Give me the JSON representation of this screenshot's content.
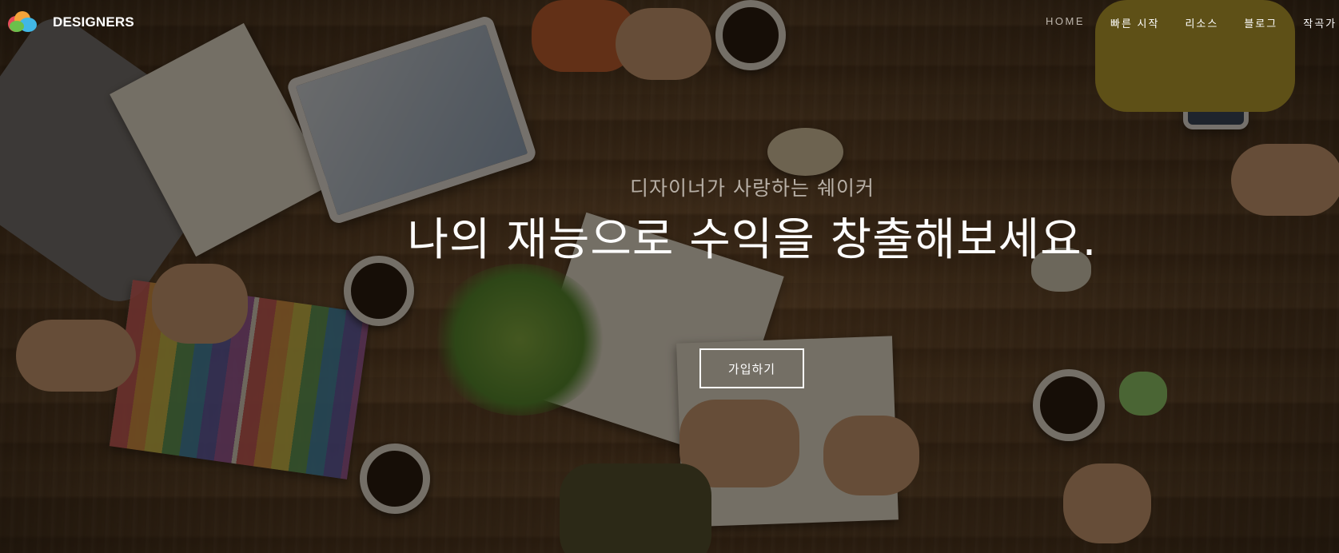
{
  "brand": {
    "name": "DESIGNERS",
    "logo_icon": "colorful-cloud-logo-icon",
    "logo_colors": [
      "#e84b5b",
      "#f3a33a",
      "#41b7e6",
      "#6bc04b"
    ]
  },
  "nav": {
    "items": [
      {
        "label": "HOME",
        "active": true
      },
      {
        "label": "빠른 시작",
        "active": false
      },
      {
        "label": "리소스",
        "active": false
      },
      {
        "label": "블로그",
        "active": false
      },
      {
        "label": "작곡가",
        "active": false
      }
    ]
  },
  "hero": {
    "subtitle": "디자이너가 사랑하는 쉐이커",
    "headline": "나의 재능으로 수익을 창출해보세요.",
    "cta_label": "가입하기",
    "background": "overhead photo of people working at a wooden desk"
  },
  "colors": {
    "text": "#ffffff",
    "muted_text": "#b7afa6",
    "overlay": "rgba(20,14,8,0.55)"
  }
}
